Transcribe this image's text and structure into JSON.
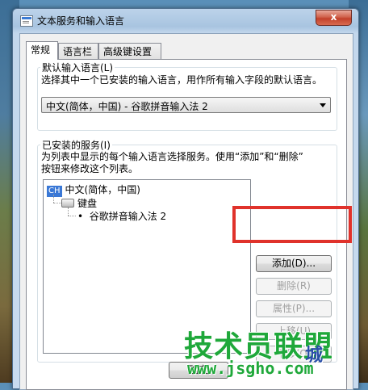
{
  "window": {
    "title": "文本服务和输入语言",
    "close_glyph": "x"
  },
  "tabs": [
    {
      "label": "常规",
      "active": true
    },
    {
      "label": "语言栏",
      "active": false
    },
    {
      "label": "高级键设置",
      "active": false
    }
  ],
  "default_language": {
    "group_label": "默认输入语言(L)",
    "description": "选择其中一个已安装的输入语言，用作所有输入字段的默认语言。",
    "selected": "中文(简体，中国) - 谷歌拼音输入法 2"
  },
  "installed_services": {
    "group_label": "已安装的服务(I)",
    "description_line1": "为列表中显示的每个输入语言选择服务。使用“添加”和“删除”",
    "description_line2": "按钮来修改这个列表。",
    "tree": {
      "language_badge": "CH",
      "language": "中文(简体，中国)",
      "category": "键盘",
      "bullet": "•",
      "service": "谷歌拼音输入法 2"
    },
    "buttons": {
      "add": "添加(D)...",
      "remove": "删除(R)",
      "properties": "属性(P)...",
      "move_up": "上移(U)",
      "move_down": "下移(O)"
    }
  },
  "footer": {
    "ok_partial": "确定"
  },
  "watermark": {
    "brand": "技术员联盟",
    "city": "城",
    "url": "www.jsgho.com"
  },
  "annotation_color": "#e0322b"
}
